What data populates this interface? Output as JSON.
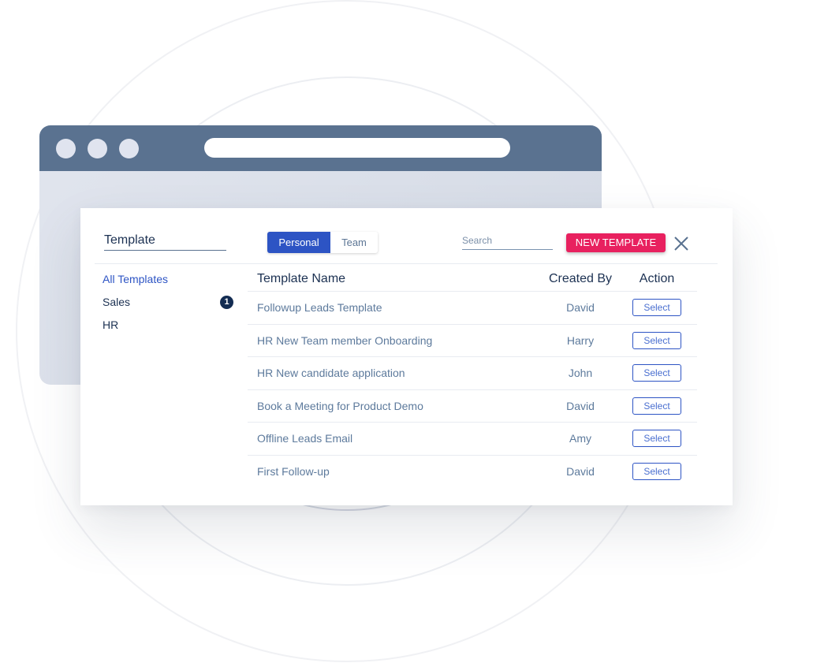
{
  "header": {
    "title_value": "Template",
    "tabs": [
      {
        "label": "Personal",
        "active": true
      },
      {
        "label": "Team",
        "active": false
      }
    ],
    "search_placeholder": "Search",
    "new_button_label": "NEW TEMPLATE",
    "close_icon": "close-icon"
  },
  "sidebar": {
    "items": [
      {
        "label": "All Templates",
        "active": true
      },
      {
        "label": "Sales",
        "badge": "1"
      },
      {
        "label": "HR"
      }
    ]
  },
  "table": {
    "columns": [
      "Template Name",
      "Created By",
      "Action"
    ],
    "rows": [
      {
        "name": "Followup Leads Template",
        "created_by": "David",
        "action": "Select"
      },
      {
        "name": "HR New Team member Onboarding",
        "created_by": "Harry",
        "action": "Select"
      },
      {
        "name": "HR New candidate application",
        "created_by": "John",
        "action": "Select"
      },
      {
        "name": "Book a Meeting for Product Demo",
        "created_by": "David",
        "action": "Select"
      },
      {
        "name": "Offline Leads Email",
        "created_by": "Amy",
        "action": "Select"
      },
      {
        "name": "First Follow-up",
        "created_by": "David",
        "action": "Select"
      }
    ]
  },
  "colors": {
    "accent": "#2d54c4",
    "primary_action": "#e8215f",
    "browser_bar": "#5a7290",
    "text_dark": "#1c3152",
    "text_muted": "#5d7a9c"
  }
}
